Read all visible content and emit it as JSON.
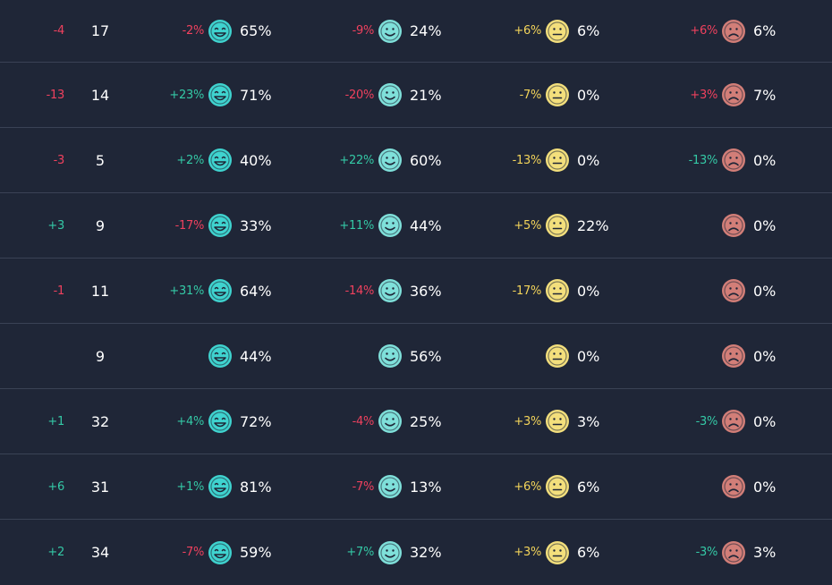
{
  "colors": {
    "background": "#1f2637",
    "divider": "#3a4255",
    "negative": "#f0415e",
    "positive": "#34c9a6",
    "yellow_delta": "#f3d45a",
    "very_happy": "#3fd3cf",
    "happy": "#7fe0da",
    "neutral": "#f3df7c",
    "sad": "#d27e78"
  },
  "icons": [
    "very-happy-face-icon",
    "happy-face-icon",
    "neutral-face-icon",
    "sad-face-icon"
  ],
  "rows": [
    {
      "count_delta": "-4",
      "count_delta_tone": "neg",
      "count": "17",
      "s1": {
        "delta": "-2%",
        "tone": "neg",
        "pct": "65%"
      },
      "s2": {
        "delta": "-9%",
        "tone": "neg",
        "pct": "24%"
      },
      "s3": {
        "delta": "+6%",
        "tone": "yellow",
        "pct": "6%"
      },
      "s4": {
        "delta": "+6%",
        "tone": "neg",
        "pct": "6%"
      }
    },
    {
      "count_delta": "-13",
      "count_delta_tone": "neg",
      "count": "14",
      "s1": {
        "delta": "+23%",
        "tone": "pos",
        "pct": "71%"
      },
      "s2": {
        "delta": "-20%",
        "tone": "neg",
        "pct": "21%"
      },
      "s3": {
        "delta": "-7%",
        "tone": "yellow",
        "pct": "0%"
      },
      "s4": {
        "delta": "+3%",
        "tone": "neg",
        "pct": "7%"
      }
    },
    {
      "count_delta": "-3",
      "count_delta_tone": "neg",
      "count": "5",
      "s1": {
        "delta": "+2%",
        "tone": "pos",
        "pct": "40%"
      },
      "s2": {
        "delta": "+22%",
        "tone": "pos",
        "pct": "60%"
      },
      "s3": {
        "delta": "-13%",
        "tone": "yellow",
        "pct": "0%"
      },
      "s4": {
        "delta": "-13%",
        "tone": "pos",
        "pct": "0%"
      }
    },
    {
      "count_delta": "+3",
      "count_delta_tone": "pos",
      "count": "9",
      "s1": {
        "delta": "-17%",
        "tone": "neg",
        "pct": "33%"
      },
      "s2": {
        "delta": "+11%",
        "tone": "pos",
        "pct": "44%"
      },
      "s3": {
        "delta": "+5%",
        "tone": "yellow",
        "pct": "22%"
      },
      "s4": {
        "delta": "",
        "tone": "pos",
        "pct": "0%"
      }
    },
    {
      "count_delta": "-1",
      "count_delta_tone": "neg",
      "count": "11",
      "s1": {
        "delta": "+31%",
        "tone": "pos",
        "pct": "64%"
      },
      "s2": {
        "delta": "-14%",
        "tone": "neg",
        "pct": "36%"
      },
      "s3": {
        "delta": "-17%",
        "tone": "yellow",
        "pct": "0%"
      },
      "s4": {
        "delta": "",
        "tone": "pos",
        "pct": "0%"
      }
    },
    {
      "count_delta": "",
      "count_delta_tone": "pos",
      "count": "9",
      "s1": {
        "delta": "",
        "tone": "pos",
        "pct": "44%"
      },
      "s2": {
        "delta": "",
        "tone": "pos",
        "pct": "56%"
      },
      "s3": {
        "delta": "",
        "tone": "yellow",
        "pct": "0%"
      },
      "s4": {
        "delta": "",
        "tone": "pos",
        "pct": "0%"
      }
    },
    {
      "count_delta": "+1",
      "count_delta_tone": "pos",
      "count": "32",
      "s1": {
        "delta": "+4%",
        "tone": "pos",
        "pct": "72%"
      },
      "s2": {
        "delta": "-4%",
        "tone": "neg",
        "pct": "25%"
      },
      "s3": {
        "delta": "+3%",
        "tone": "yellow",
        "pct": "3%"
      },
      "s4": {
        "delta": "-3%",
        "tone": "pos",
        "pct": "0%"
      }
    },
    {
      "count_delta": "+6",
      "count_delta_tone": "pos",
      "count": "31",
      "s1": {
        "delta": "+1%",
        "tone": "pos",
        "pct": "81%"
      },
      "s2": {
        "delta": "-7%",
        "tone": "neg",
        "pct": "13%"
      },
      "s3": {
        "delta": "+6%",
        "tone": "yellow",
        "pct": "6%"
      },
      "s4": {
        "delta": "",
        "tone": "pos",
        "pct": "0%"
      }
    },
    {
      "count_delta": "+2",
      "count_delta_tone": "pos",
      "count": "34",
      "s1": {
        "delta": "-7%",
        "tone": "neg",
        "pct": "59%"
      },
      "s2": {
        "delta": "+7%",
        "tone": "pos",
        "pct": "32%"
      },
      "s3": {
        "delta": "+3%",
        "tone": "yellow",
        "pct": "6%"
      },
      "s4": {
        "delta": "-3%",
        "tone": "pos",
        "pct": "3%"
      }
    }
  ]
}
